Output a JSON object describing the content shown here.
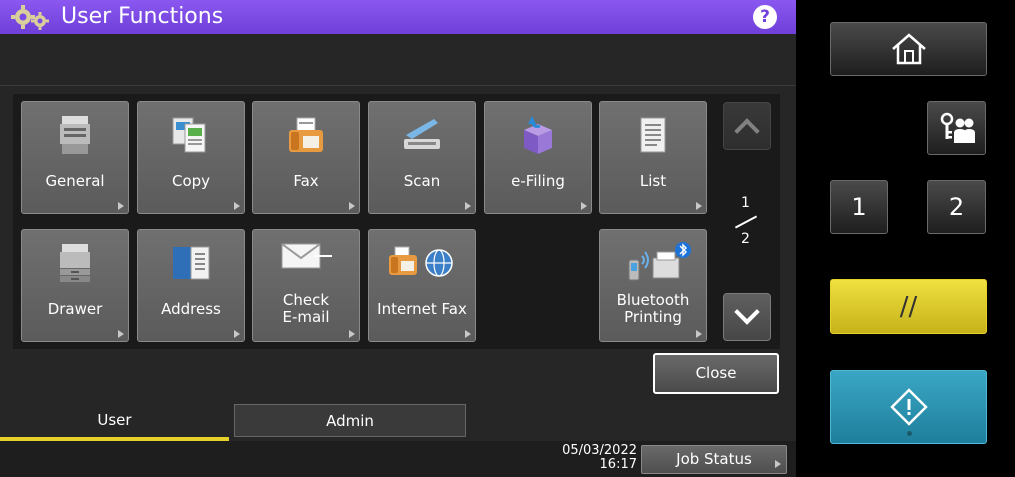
{
  "title": "User Functions",
  "help_label": "?",
  "tiles": [
    {
      "label": "General",
      "icon": "copier-icon"
    },
    {
      "label": "Copy",
      "icon": "copy-pages-icon"
    },
    {
      "label": "Fax",
      "icon": "fax-machine-icon"
    },
    {
      "label": "Scan",
      "icon": "scanner-icon"
    },
    {
      "label": "e-Filing",
      "icon": "efiling-box-icon"
    },
    {
      "label": "List",
      "icon": "list-document-icon"
    },
    {
      "label": "Drawer",
      "icon": "drawer-printer-icon"
    },
    {
      "label": "Address",
      "icon": "address-book-icon"
    },
    {
      "label_line1": "Check",
      "label_line2": "E-mail",
      "icon": "envelope-icon"
    },
    {
      "label": "Internet Fax",
      "icon": "internet-fax-icon"
    },
    {
      "label_line1": "Bluetooth",
      "label_line2": "Printing",
      "icon": "bluetooth-printer-icon"
    }
  ],
  "pager": {
    "current": "1",
    "total": "2"
  },
  "close_label": "Close",
  "tabs": [
    {
      "label": "User",
      "active": true
    },
    {
      "label": "Admin",
      "active": false
    }
  ],
  "footer": {
    "date": "05/03/2022",
    "time": "16:17",
    "job_status_label": "Job Status"
  },
  "hardware": {
    "button_1": "1",
    "button_2": "2",
    "reset_symbol": "//"
  },
  "colors": {
    "title_bar": "#7a4ae6",
    "active_tab_underline": "#e6d12a",
    "reset_button": "#e6d12a",
    "start_button": "#2b93b1"
  }
}
